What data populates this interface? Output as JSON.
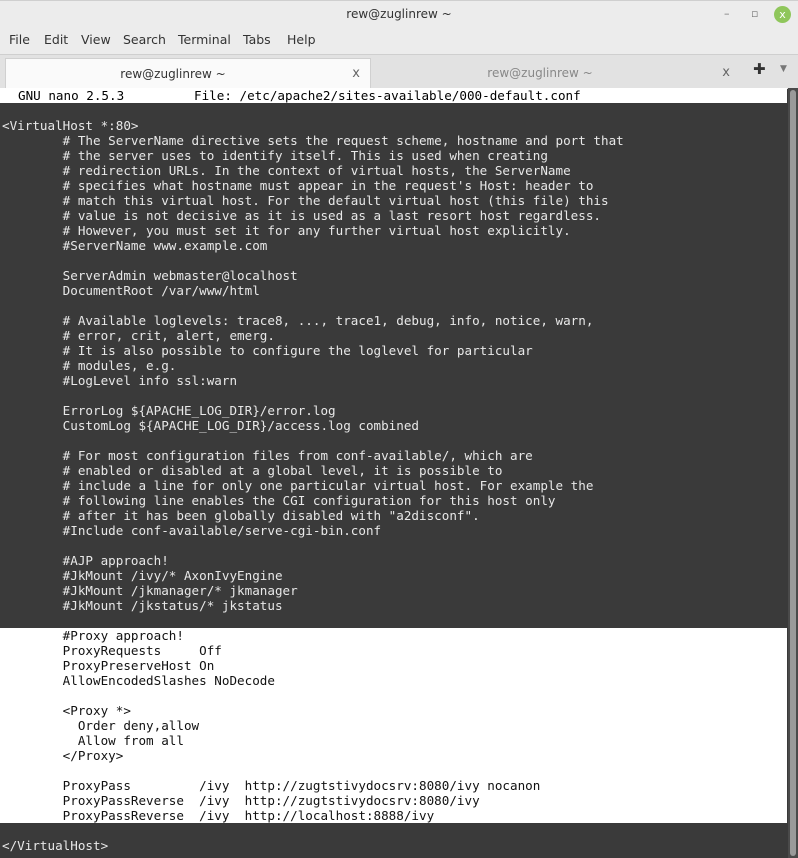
{
  "window": {
    "title": "rew@zuglinrew ~",
    "minimize": "–",
    "maximize": "▫",
    "close": "x"
  },
  "menu": [
    "File",
    "Edit",
    "View",
    "Search",
    "Terminal",
    "Tabs",
    "Help"
  ],
  "tabs": [
    {
      "label": "rew@zuglinrew ~",
      "active": true,
      "close": "x"
    },
    {
      "label": "rew@zuglinrew ~",
      "active": false,
      "close": "x"
    }
  ],
  "new_tab": "✚",
  "tab_menu": "▼",
  "nano": {
    "version": "GNU nano 2.5.3",
    "file": "File: /etc/apache2/sites-available/000-default.conf"
  },
  "selection": {
    "first_line": 34,
    "last_line": 46
  },
  "lines": [
    "<VirtualHost *:80>",
    "        # The ServerName directive sets the request scheme, hostname and port that",
    "        # the server uses to identify itself. This is used when creating",
    "        # redirection URLs. In the context of virtual hosts, the ServerName",
    "        # specifies what hostname must appear in the request's Host: header to",
    "        # match this virtual host. For the default virtual host (this file) this",
    "        # value is not decisive as it is used as a last resort host regardless.",
    "        # However, you must set it for any further virtual host explicitly.",
    "        #ServerName www.example.com",
    "",
    "        ServerAdmin webmaster@localhost",
    "        DocumentRoot /var/www/html",
    "",
    "        # Available loglevels: trace8, ..., trace1, debug, info, notice, warn,",
    "        # error, crit, alert, emerg.",
    "        # It is also possible to configure the loglevel for particular",
    "        # modules, e.g.",
    "        #LogLevel info ssl:warn",
    "",
    "        ErrorLog ${APACHE_LOG_DIR}/error.log",
    "        CustomLog ${APACHE_LOG_DIR}/access.log combined",
    "",
    "        # For most configuration files from conf-available/, which are",
    "        # enabled or disabled at a global level, it is possible to",
    "        # include a line for only one particular virtual host. For example the",
    "        # following line enables the CGI configuration for this host only",
    "        # after it has been globally disabled with \"a2disconf\".",
    "        #Include conf-available/serve-cgi-bin.conf",
    "",
    "        #AJP approach!",
    "        #JkMount /ivy/* AxonIvyEngine",
    "        #JkMount /jkmanager/* jkmanager",
    "        #JkMount /jkstatus/* jkstatus",
    "",
    "        #Proxy approach!",
    "        ProxyRequests     Off",
    "        ProxyPreserveHost On",
    "        AllowEncodedSlashes NoDecode",
    "",
    "        <Proxy *>",
    "          Order deny,allow",
    "          Allow from all",
    "        </Proxy>",
    "",
    "        ProxyPass         /ivy  http://zugtstivydocsrv:8080/ivy nocanon",
    "        ProxyPassReverse  /ivy  http://zugtstivydocsrv:8080/ivy",
    "        ProxyPassReverse  /ivy  http://localhost:8888/ivy",
    "",
    "</VirtualHost>"
  ]
}
